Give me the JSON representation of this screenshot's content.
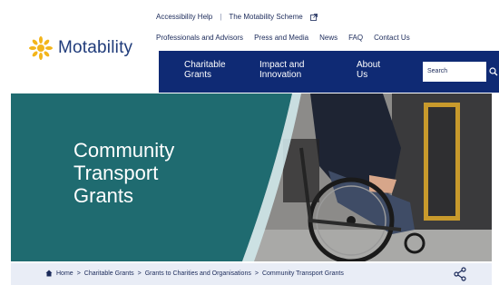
{
  "header": {
    "logo_text": "Motability",
    "logo_icon": "sunburst-logo-icon",
    "utility_links": {
      "accessibility": "Accessibility Help",
      "separator": "|",
      "scheme": "The Motability Scheme"
    },
    "secondary_nav": [
      "Professionals and Advisors",
      "Press and Media",
      "News",
      "FAQ",
      "Contact Us"
    ],
    "main_nav": [
      {
        "label": "Charitable\nGrants"
      },
      {
        "label": "Impact and\nInnovation"
      },
      {
        "label": "About\nUs"
      }
    ],
    "search_placeholder": "Search"
  },
  "hero": {
    "title": "Community\nTransport\nGrants"
  },
  "breadcrumb": {
    "items": [
      "Home",
      "Charitable Grants",
      "Grants to Charities and Organisations",
      "Community Transport Grants"
    ],
    "separator": ">"
  },
  "colors": {
    "brand_navy": "#0f2a74",
    "hero_teal": "#1f6b70",
    "breadcrumb_bg": "#e9edf6",
    "logo_yellow": "#f3b51b"
  }
}
